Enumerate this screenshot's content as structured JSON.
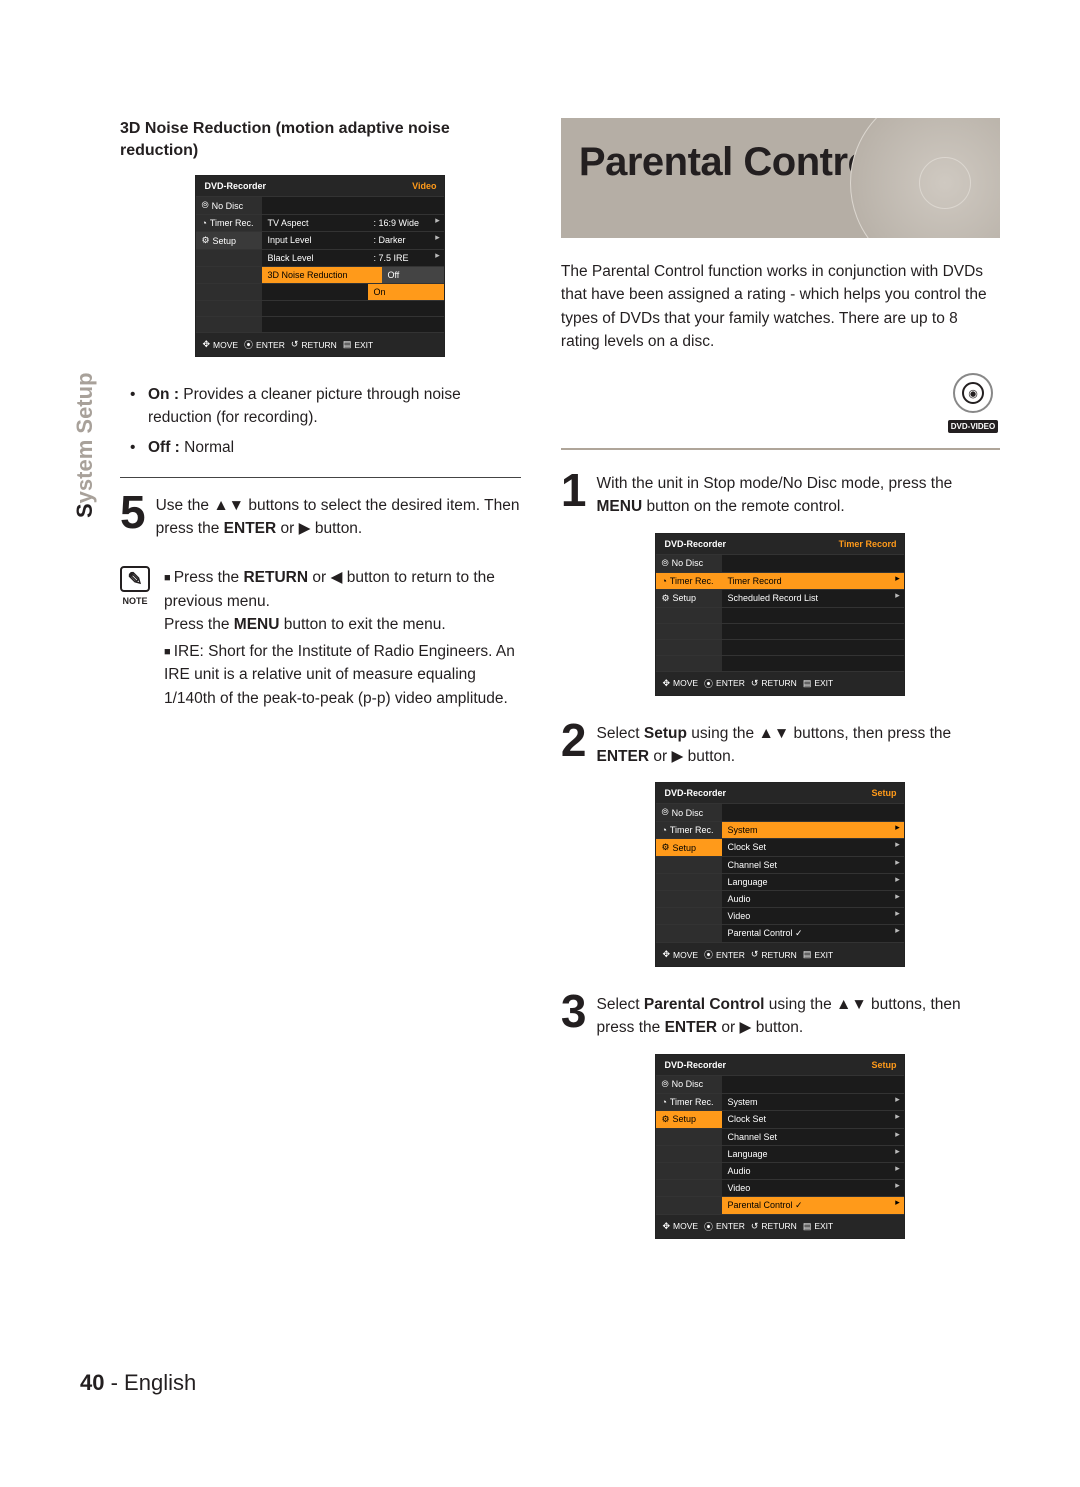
{
  "left": {
    "side_label_s": "S",
    "side_label_rest": "ystem Setup",
    "heading": "3D Noise Reduction (motion adaptive noise reduction)",
    "osd1": {
      "title_left": "DVD-Recorder",
      "title_right": "Video",
      "side": [
        "No Disc",
        "Timer Rec.",
        "Setup"
      ],
      "rows": [
        {
          "label": "TV Aspect",
          "value": ": 16:9 Wide"
        },
        {
          "label": "Input Level",
          "value": ": Darker"
        },
        {
          "label": "Black Level",
          "value": ": 7.5 IRE"
        },
        {
          "label": "3D Noise Reduction",
          "value": ""
        }
      ],
      "dropdown": [
        "Off",
        "On"
      ],
      "footer": {
        "move": "MOVE",
        "enter": "ENTER",
        "return": "RETURN",
        "exit": "EXIT"
      }
    },
    "bullets_on_bold": "On :",
    "bullets_on_rest": " Provides a cleaner picture through noise reduction (for recording).",
    "bullets_off_bold": "Off :",
    "bullets_off_rest": " Normal",
    "step5_num": "5",
    "step5_a": "Use the ",
    "step5_b": " buttons to select the desired item.  Then press the ",
    "step5_enter": "ENTER",
    "step5_c": " or ",
    "step5_d": " button.",
    "note_label": "NOTE",
    "note_1a": "Press the ",
    "note_1_return": "RETURN",
    "note_1b": " or ",
    "note_1c": " button to return to the previous menu.",
    "note_1d": "Press the ",
    "note_1_menu": "MENU",
    "note_1e": " button to exit the menu.",
    "note_2": "IRE: Short for the Institute of Radio Engineers. An IRE unit is a relative unit of measure equaling 1/140th of the peak-to-peak (p-p) video amplitude."
  },
  "right": {
    "hero_title": "Parental Control",
    "intro": "The Parental Control function works in conjunction with DVDs that have been assigned a rating - which helps you control the types of DVDs that your family watches. There are up to 8 rating levels on a disc.",
    "badge_label": "DVD-VIDEO",
    "step1_num": "1",
    "step1_a": "With the unit in Stop mode/No Disc mode, press the ",
    "step1_menu": "MENU",
    "step1_b": " button on the remote control.",
    "osd2": {
      "title_left": "DVD-Recorder",
      "title_right": "Timer Record",
      "side": [
        "No Disc",
        "Timer Rec.",
        "Setup"
      ],
      "rows": [
        {
          "label": "Timer Record"
        },
        {
          "label": "Scheduled Record List"
        }
      ],
      "footer": {
        "move": "MOVE",
        "enter": "ENTER",
        "return": "RETURN",
        "exit": "EXIT"
      }
    },
    "step2_num": "2",
    "step2_a": "Select ",
    "step2_setup": "Setup",
    "step2_b": " using the ",
    "step2_c": " buttons, then press the ",
    "step2_enter": "ENTER",
    "step2_d": " or ",
    "step2_e": " button.",
    "osd3": {
      "title_left": "DVD-Recorder",
      "title_right": "Setup",
      "side": [
        "No Disc",
        "Timer Rec.",
        "Setup"
      ],
      "rows": [
        {
          "label": "System"
        },
        {
          "label": "Clock Set"
        },
        {
          "label": "Channel Set"
        },
        {
          "label": "Language"
        },
        {
          "label": "Audio"
        },
        {
          "label": "Video"
        },
        {
          "label": "Parental Control ✓"
        }
      ],
      "highlight": 0,
      "footer": {
        "move": "MOVE",
        "enter": "ENTER",
        "return": "RETURN",
        "exit": "EXIT"
      }
    },
    "step3_num": "3",
    "step3_a": "Select ",
    "step3_pc": "Parental Control",
    "step3_b": " using the ",
    "step3_c": " buttons, then press the ",
    "step3_enter": "ENTER",
    "step3_d": " or ",
    "step3_e": " button.",
    "osd4": {
      "title_left": "DVD-Recorder",
      "title_right": "Setup",
      "side": [
        "No Disc",
        "Timer Rec.",
        "Setup"
      ],
      "rows": [
        {
          "label": "System"
        },
        {
          "label": "Clock Set"
        },
        {
          "label": "Channel Set"
        },
        {
          "label": "Language"
        },
        {
          "label": "Audio"
        },
        {
          "label": "Video"
        },
        {
          "label": "Parental Control ✓"
        }
      ],
      "highlight": 6,
      "footer": {
        "move": "MOVE",
        "enter": "ENTER",
        "return": "RETURN",
        "exit": "EXIT"
      }
    }
  },
  "footer": {
    "page": "40",
    "sep": " - ",
    "lang": "English"
  },
  "glyphs": {
    "updown": "▲▼",
    "right": "▶",
    "left": "◀",
    "move": "✥",
    "enter": "⦿",
    "return": "↺",
    "exit": "▤"
  }
}
